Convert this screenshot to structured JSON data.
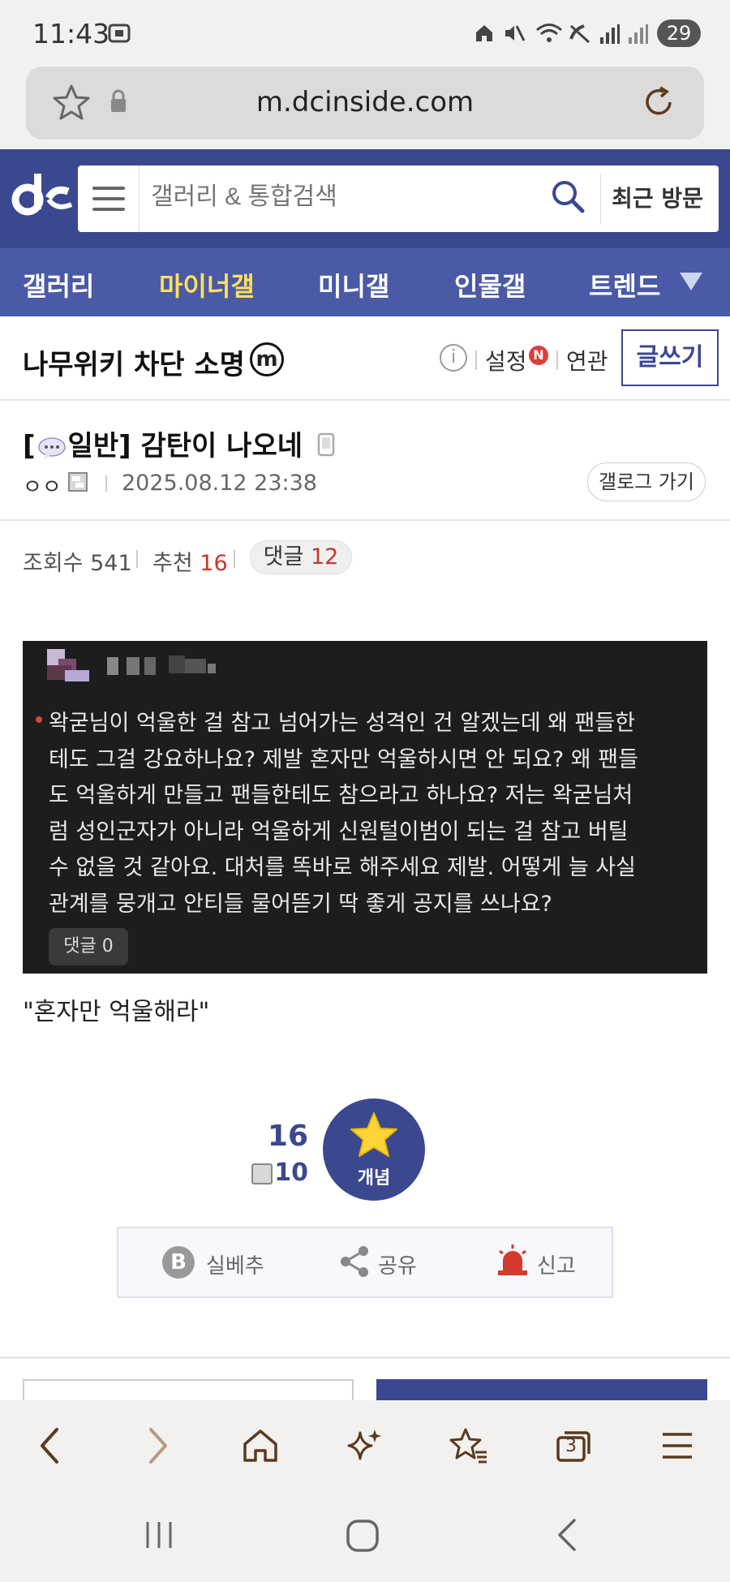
{
  "status_bar": {
    "time": "11:43",
    "battery": "29"
  },
  "browser": {
    "url": "m.dcinside.com",
    "tab_count": "3"
  },
  "header": {
    "search_placeholder": "갤러리 & 통합검색",
    "recent_visit": "최근 방문"
  },
  "nav": {
    "items": [
      "갤러리",
      "마이너갤",
      "미니갤",
      "인물갤",
      "트렌드"
    ],
    "active_index": 1
  },
  "gallery": {
    "title": "나무위키 차단 소명",
    "badge": "m",
    "settings": "설정",
    "new_badge": "N",
    "related": "연관",
    "write": "글쓰기"
  },
  "post": {
    "head_prefix": "[",
    "category": "일반",
    "head_suffix": "]",
    "title": "감탄이 나오네",
    "author": "ㅇㅇ",
    "date": "2025.08.12 23:38",
    "gallog_button": "갤로그 가기",
    "views_label": "조회수",
    "views": "541",
    "recommend_label": "추천",
    "recommend": "16",
    "comments_label": "댓글",
    "comments": "12"
  },
  "embedded_image": {
    "text_lines": [
      "왁굳님이 억울한 걸 참고 넘어가는 성격인 건 알겠는데 왜 팬들한",
      "테도 그걸 강요하나요? 제발 혼자만 억울하시면 안 되요? 왜 팬들",
      "도 억울하게 만들고 팬들한테도 참으라고 하나요? 저는 왁굳님처",
      "럼 성인군자가 아니라 억울하게 신원털이범이 되는 걸 참고 버틸",
      "수 없을 것 같아요. 대처를 똑바로 해주세요 제발. 어떻게 늘 사실",
      "관계를 뭉개고 안티들 물어뜯기 딱 좋게 공지를 쓰나요?"
    ],
    "comment_badge": "댓글 0"
  },
  "caption": "\"혼자만 억울해라\"",
  "recommend_box": {
    "total": "16",
    "fixed": "10",
    "button_label": "개념"
  },
  "actions": {
    "best": "실베추",
    "best_icon": "B",
    "share": "공유",
    "report": "신고"
  },
  "colors": {
    "brand": "#3b4890",
    "nav": "#4a5aa6",
    "active_nav": "#ffe05a",
    "accent_red": "#c0392b"
  }
}
